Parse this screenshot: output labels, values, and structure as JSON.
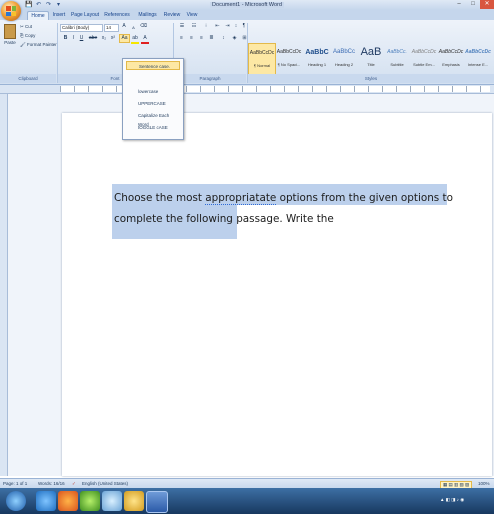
{
  "window": {
    "title": "Document1 - Microsoft Word",
    "controls": [
      "–",
      "□",
      "✕"
    ]
  },
  "quick_access": {
    "icons": [
      "save-icon",
      "undo-icon",
      "redo-icon",
      "customize-icon"
    ],
    "glyphs": [
      "💾",
      "↶",
      "↷",
      "▾"
    ]
  },
  "tabs": [
    "Home",
    "Insert",
    "Page Layout",
    "References",
    "Mailings",
    "Review",
    "View"
  ],
  "clipboard": {
    "paste": "Paste",
    "cut": "Cut",
    "copy": "Copy",
    "format_painter": "Format Painter",
    "label": "Clipboard"
  },
  "font": {
    "name": "Calibri (Body)",
    "size": "14",
    "grow": "A",
    "shrink": "A",
    "bold": "B",
    "italic": "I",
    "underline": "U",
    "strike": "abe",
    "sub": "x₂",
    "sup": "x²",
    "change_case": "Aa",
    "label": "Font"
  },
  "paragraph": {
    "label": "Paragraph",
    "pilcrow": "¶"
  },
  "styles": {
    "label": "Styles",
    "items": [
      {
        "preview": "AaBbCcDc",
        "name": "¶ Normal",
        "selected": true
      },
      {
        "preview": "AaBbCcDc",
        "name": "¶ No Spaci..."
      },
      {
        "preview": "AaBbC",
        "name": "Heading 1"
      },
      {
        "preview": "AaBbCc",
        "name": "Heading 2"
      },
      {
        "preview": "AaB",
        "name": "Title"
      },
      {
        "preview": "AaBbCc.",
        "name": "Subtitle"
      },
      {
        "preview": "AaBbCcDc",
        "name": "Subtle Em..."
      },
      {
        "preview": "AaBbCcDc",
        "name": "Emphasis"
      },
      {
        "preview": "AaBbCcDc",
        "name": "Intense E..."
      }
    ]
  },
  "case_menu": {
    "items": [
      "Sentence case.",
      "lowercase",
      "UPPERCASE",
      "Capitalize Each Word",
      "tOGGLE cASE"
    ],
    "highlighted": 0
  },
  "document": {
    "text_before": "Choose the most ",
    "text_squiggle": "appropriatate",
    "text_after": " options from the given options to complete the following passage. Write the"
  },
  "status": {
    "page": "Page: 1 of 1",
    "words": "Words: 16/16",
    "language": "English (United States)",
    "zoom": "100%"
  },
  "taskbar": {
    "icons": [
      "windows-start-icon",
      "internet-explorer-icon",
      "firefox-icon",
      "media-icon",
      "paint-icon",
      "folder-icon",
      "word-icon"
    ]
  }
}
